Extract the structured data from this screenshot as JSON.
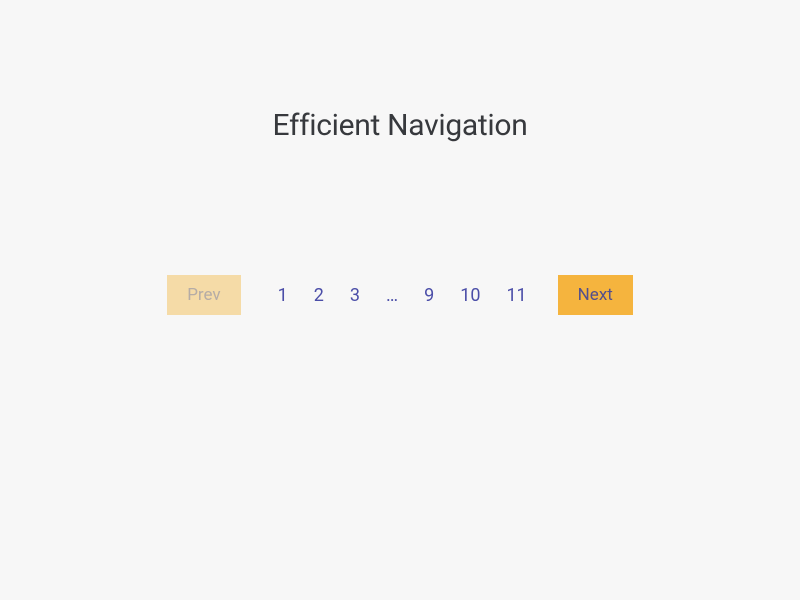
{
  "heading": "Efficient Navigation",
  "pagination": {
    "prev_label": "Prev",
    "next_label": "Next",
    "pages": [
      "1",
      "2",
      "3",
      "…",
      "9",
      "10",
      "11"
    ]
  }
}
